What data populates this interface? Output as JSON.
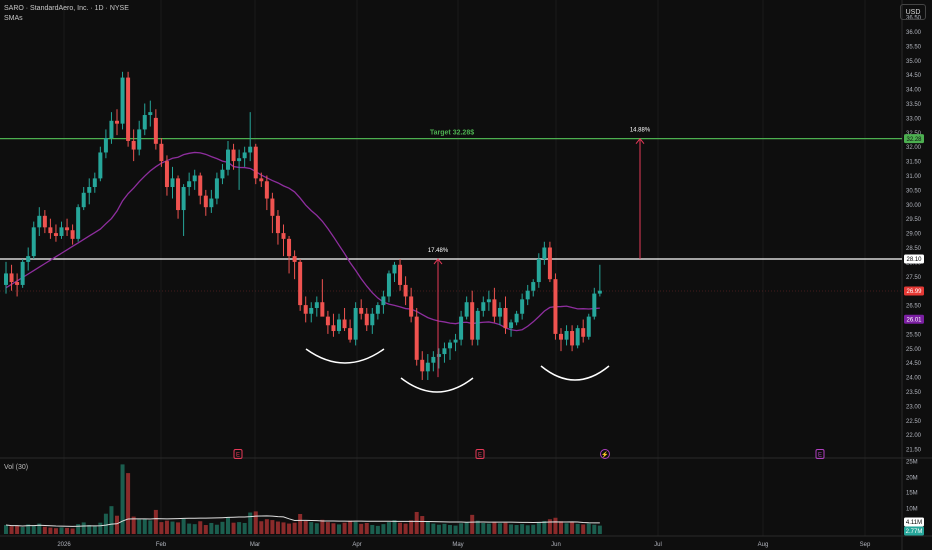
{
  "header": {
    "title": "SARO · StandardAero, Inc. · 1D · NYSE",
    "indicator": "SMAs",
    "currency": "USD",
    "volume_label": "Vol (30)"
  },
  "chart_data": {
    "type": "candlestick",
    "symbol": "SARO",
    "price_axis": {
      "ylim": [
        21.0,
        37.0
      ],
      "ticks": [
        "36.50",
        "36.00",
        "35.50",
        "35.00",
        "34.50",
        "34.00",
        "33.50",
        "33.00",
        "32.50",
        "32.00",
        "31.50",
        "31.00",
        "30.50",
        "30.00",
        "29.50",
        "29.00",
        "28.50",
        "28.00",
        "27.50",
        "27.00",
        "26.50",
        "26.00",
        "25.50",
        "25.00",
        "24.50",
        "24.00",
        "23.50",
        "23.00",
        "22.50",
        "22.00",
        "21.50"
      ]
    },
    "x_axis": {
      "labels": [
        "2026",
        "Feb",
        "Mar",
        "Apr",
        "May",
        "Jun",
        "Jul",
        "Aug",
        "Sep"
      ]
    },
    "volume_axis": {
      "ticks": [
        "25M",
        "20M",
        "15M",
        "10M"
      ]
    },
    "levels": [
      {
        "price": 32.28,
        "label": "Target 32.28$",
        "badge": "32.28",
        "color": "#4caf50"
      },
      {
        "price": 28.1,
        "label": "",
        "badge": "28.10",
        "color": "#ffffff"
      }
    ],
    "badges": [
      {
        "price": 26.99,
        "text": "26.99",
        "color": "#e53935"
      },
      {
        "price": 26.01,
        "text": "26.01",
        "color": "#7b1fa2"
      }
    ],
    "volume_badges": [
      {
        "text": "4.11M",
        "color": "#ffffff",
        "textColor": "#000000"
      },
      {
        "text": "2.77M",
        "color": "#26a69a",
        "textColor": "#ffffff"
      }
    ],
    "annotations": [
      {
        "text": "17.48%",
        "from_price": 24.0,
        "to_price": 28.1
      },
      {
        "text": "14.88%",
        "from_price": 28.1,
        "to_price": 32.28
      }
    ],
    "event_markers": [
      "E",
      "E",
      "⚡",
      "E"
    ],
    "candles": [
      [
        27.2,
        28.0,
        26.9,
        27.6
      ],
      [
        27.6,
        27.9,
        27.0,
        27.3
      ],
      [
        27.3,
        27.6,
        26.8,
        27.2
      ],
      [
        27.2,
        28.1,
        27.1,
        28.0
      ],
      [
        28.0,
        28.5,
        27.7,
        28.2
      ],
      [
        28.2,
        29.4,
        28.1,
        29.2
      ],
      [
        29.2,
        29.9,
        28.9,
        29.6
      ],
      [
        29.6,
        29.8,
        29.0,
        29.2
      ],
      [
        29.2,
        29.5,
        28.8,
        29.0
      ],
      [
        29.0,
        29.3,
        28.7,
        28.9
      ],
      [
        28.9,
        29.4,
        28.8,
        29.2
      ],
      [
        29.2,
        29.5,
        28.9,
        29.1
      ],
      [
        29.1,
        29.3,
        28.6,
        28.8
      ],
      [
        28.8,
        30.0,
        28.7,
        29.9
      ],
      [
        29.9,
        30.6,
        29.8,
        30.4
      ],
      [
        30.4,
        30.9,
        30.0,
        30.6
      ],
      [
        30.6,
        31.1,
        30.4,
        30.9
      ],
      [
        30.9,
        32.0,
        30.8,
        31.8
      ],
      [
        31.8,
        32.6,
        31.6,
        32.3
      ],
      [
        32.3,
        33.2,
        32.1,
        32.9
      ],
      [
        32.9,
        33.3,
        32.4,
        32.8
      ],
      [
        32.8,
        34.6,
        32.6,
        34.4
      ],
      [
        34.4,
        34.6,
        32.0,
        32.2
      ],
      [
        32.2,
        32.6,
        31.5,
        31.9
      ],
      [
        31.9,
        32.9,
        31.7,
        32.6
      ],
      [
        32.6,
        33.5,
        32.4,
        33.1
      ],
      [
        33.1,
        33.6,
        32.7,
        33.2
      ],
      [
        33.0,
        33.3,
        31.9,
        32.1
      ],
      [
        32.1,
        32.3,
        31.3,
        31.5
      ],
      [
        31.5,
        31.7,
        30.3,
        30.6
      ],
      [
        30.6,
        31.3,
        30.2,
        30.9
      ],
      [
        30.9,
        31.0,
        29.5,
        29.8
      ],
      [
        29.8,
        30.7,
        28.9,
        30.6
      ],
      [
        30.6,
        31.1,
        30.3,
        30.8
      ],
      [
        30.8,
        31.2,
        30.5,
        31.0
      ],
      [
        31.0,
        31.1,
        30.0,
        30.3
      ],
      [
        30.3,
        30.5,
        29.6,
        29.9
      ],
      [
        29.9,
        30.5,
        29.7,
        30.2
      ],
      [
        30.2,
        31.1,
        30.0,
        30.9
      ],
      [
        30.9,
        31.4,
        30.7,
        31.2
      ],
      [
        31.2,
        32.2,
        31.0,
        31.9
      ],
      [
        31.9,
        32.1,
        31.2,
        31.5
      ],
      [
        31.5,
        31.9,
        30.5,
        31.6
      ],
      [
        31.6,
        32.0,
        31.3,
        31.8
      ],
      [
        31.8,
        33.2,
        31.5,
        32.0
      ],
      [
        32.0,
        32.1,
        30.7,
        30.9
      ],
      [
        30.9,
        31.1,
        30.6,
        30.8
      ],
      [
        30.8,
        31.0,
        29.8,
        30.2
      ],
      [
        30.2,
        30.4,
        29.0,
        29.6
      ],
      [
        29.6,
        29.8,
        28.6,
        29.0
      ],
      [
        29.0,
        29.3,
        28.2,
        28.8
      ],
      [
        28.8,
        28.9,
        27.6,
        28.2
      ],
      [
        28.2,
        28.4,
        27.4,
        28.0
      ],
      [
        28.0,
        28.1,
        26.3,
        26.5
      ],
      [
        26.5,
        26.8,
        25.9,
        26.2
      ],
      [
        26.2,
        26.6,
        25.9,
        26.4
      ],
      [
        26.4,
        26.8,
        26.1,
        26.6
      ],
      [
        26.6,
        27.4,
        26.3,
        26.1
      ],
      [
        26.1,
        26.3,
        25.5,
        25.8
      ],
      [
        25.8,
        26.2,
        25.4,
        25.6
      ],
      [
        25.6,
        26.2,
        25.5,
        26.0
      ],
      [
        26.0,
        26.4,
        25.6,
        25.7
      ],
      [
        25.7,
        26.0,
        25.2,
        25.3
      ],
      [
        25.3,
        26.6,
        25.1,
        26.4
      ],
      [
        26.4,
        26.7,
        26.0,
        26.2
      ],
      [
        26.2,
        26.4,
        25.6,
        25.8
      ],
      [
        25.8,
        26.4,
        25.5,
        26.2
      ],
      [
        26.2,
        26.6,
        26.0,
        26.5
      ],
      [
        26.5,
        27.0,
        26.2,
        26.8
      ],
      [
        26.8,
        27.7,
        26.6,
        27.6
      ],
      [
        27.6,
        28.0,
        27.3,
        27.9
      ],
      [
        27.9,
        28.1,
        27.0,
        27.2
      ],
      [
        27.2,
        27.5,
        26.5,
        26.8
      ],
      [
        26.8,
        27.1,
        25.9,
        26.1
      ],
      [
        26.1,
        26.4,
        24.4,
        24.6
      ],
      [
        24.6,
        24.9,
        23.9,
        24.2
      ],
      [
        24.2,
        24.8,
        23.9,
        24.5
      ],
      [
        24.5,
        24.9,
        24.2,
        24.7
      ],
      [
        24.7,
        25.0,
        24.3,
        24.8
      ],
      [
        24.8,
        25.2,
        24.5,
        25.0
      ],
      [
        25.0,
        25.3,
        24.6,
        25.2
      ],
      [
        25.2,
        25.5,
        24.9,
        25.3
      ],
      [
        25.3,
        26.3,
        25.1,
        26.1
      ],
      [
        26.1,
        26.8,
        26.0,
        26.6
      ],
      [
        26.6,
        27.0,
        25.1,
        25.3
      ],
      [
        25.3,
        26.4,
        25.1,
        26.3
      ],
      [
        26.3,
        26.8,
        26.1,
        26.6
      ],
      [
        26.6,
        27.0,
        26.3,
        26.7
      ],
      [
        26.7,
        27.1,
        25.9,
        26.1
      ],
      [
        26.1,
        26.6,
        25.8,
        26.4
      ],
      [
        26.4,
        26.8,
        25.5,
        25.7
      ],
      [
        25.7,
        26.0,
        25.4,
        25.9
      ],
      [
        25.9,
        26.3,
        25.8,
        26.2
      ],
      [
        26.2,
        26.9,
        26.0,
        26.7
      ],
      [
        26.7,
        27.2,
        26.5,
        27.0
      ],
      [
        27.0,
        27.4,
        26.8,
        27.3
      ],
      [
        27.3,
        28.3,
        27.1,
        28.1
      ],
      [
        28.1,
        28.7,
        27.9,
        28.5
      ],
      [
        28.5,
        28.7,
        27.3,
        27.4
      ],
      [
        27.4,
        27.6,
        25.3,
        25.5
      ],
      [
        25.5,
        25.7,
        24.9,
        25.3
      ],
      [
        25.3,
        25.8,
        25.1,
        25.6
      ],
      [
        25.6,
        25.8,
        24.9,
        25.1
      ],
      [
        25.1,
        25.8,
        25.0,
        25.7
      ],
      [
        25.7,
        26.0,
        25.2,
        25.4
      ],
      [
        25.4,
        26.2,
        25.3,
        26.1
      ],
      [
        26.1,
        27.1,
        26.0,
        26.9
      ],
      [
        26.9,
        27.9,
        26.8,
        27.0
      ]
    ],
    "volume": [
      3.1,
      2.7,
      2.9,
      2.4,
      3.3,
      3.0,
      3.6,
      2.5,
      2.2,
      2.0,
      2.3,
      2.1,
      1.9,
      3.4,
      4.0,
      3.1,
      2.8,
      3.9,
      7.0,
      9.6,
      6.3,
      24.0,
      21.0,
      6.0,
      5.0,
      5.3,
      4.7,
      8.3,
      4.1,
      4.6,
      4.3,
      4.0,
      5.2,
      3.6,
      3.4,
      4.4,
      3.1,
      3.8,
      3.2,
      4.2,
      5.7,
      3.9,
      4.1,
      3.8,
      7.4,
      7.8,
      4.4,
      5.1,
      4.8,
      4.3,
      4.0,
      3.6,
      3.9,
      6.9,
      4.5,
      4.1,
      3.7,
      4.9,
      4.1,
      3.7,
      3.3,
      3.9,
      4.6,
      4.2,
      3.5,
      3.8,
      3.1,
      2.8,
      3.4,
      4.1,
      4.8,
      3.9,
      3.6,
      4.7,
      7.6,
      6.2,
      4.4,
      3.6,
      3.2,
      3.5,
      3.1,
      2.9,
      3.7,
      4.1,
      6.6,
      4.6,
      3.8,
      3.6,
      4.2,
      3.7,
      3.9,
      3.3,
      3.1,
      3.4,
      3.0,
      3.2,
      4.1,
      4.5,
      5.1,
      5.6,
      4.4,
      3.7,
      4.0,
      3.5,
      3.3,
      3.6,
      3.2,
      2.9
    ]
  }
}
